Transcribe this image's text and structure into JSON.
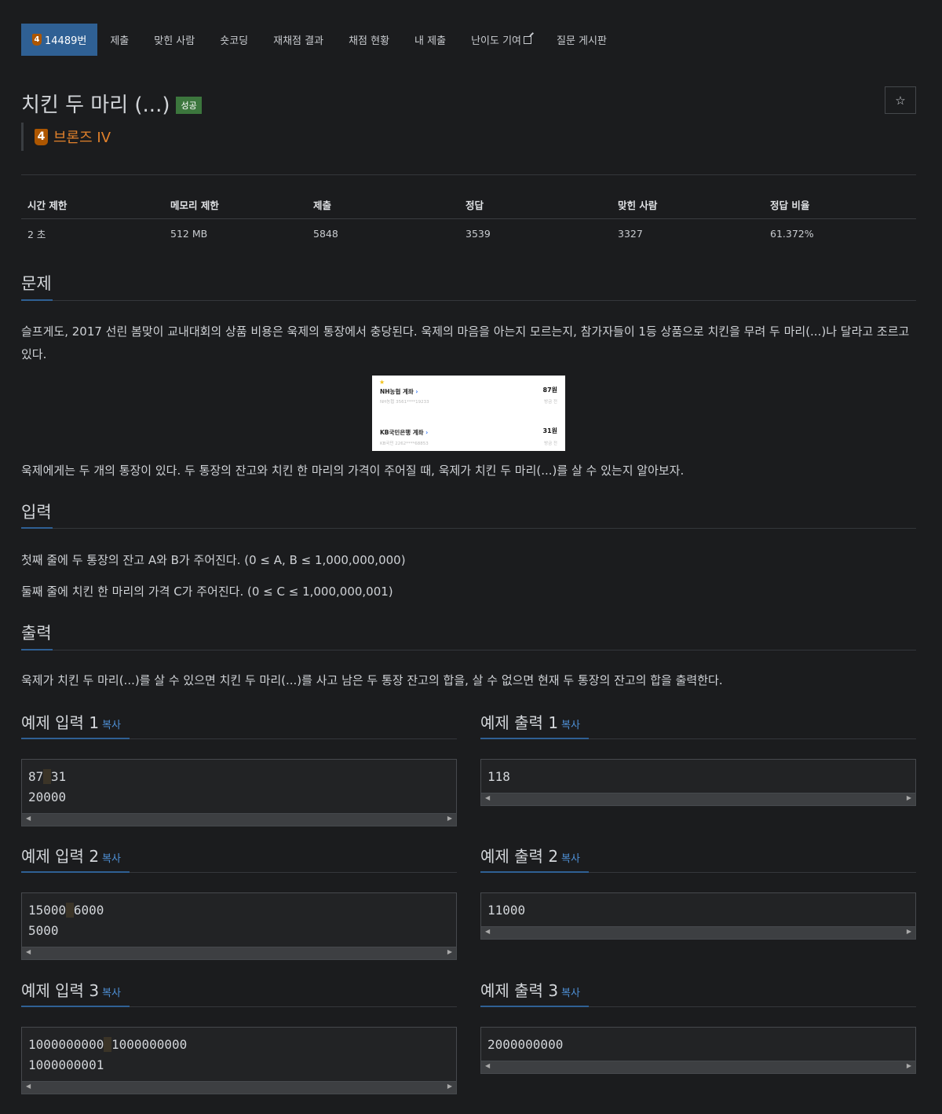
{
  "nav": {
    "problem_tier": "4",
    "problem_id": "14489번",
    "items": [
      "제출",
      "맞힌 사람",
      "숏코딩",
      "재채점 결과",
      "채점 현황",
      "내 제출",
      "난이도 기여",
      "질문 게시판"
    ]
  },
  "header": {
    "title": "치킨 두 마리 (...)",
    "status": "성공",
    "star_icon": "☆",
    "tier_num": "4",
    "tier_label": "브론즈 IV"
  },
  "stats": {
    "headers": [
      "시간 제한",
      "메모리 제한",
      "제출",
      "정답",
      "맞힌 사람",
      "정답 비율"
    ],
    "values": [
      "2 초",
      "512 MB",
      "5848",
      "3539",
      "3327",
      "61.372%"
    ]
  },
  "problem": {
    "title": "문제",
    "para1": "슬프게도, 2017 선린 봄맞이 교내대회의 상품 비용은 욱제의 통장에서 충당된다. 욱제의 마음을 아는지 모르는지, 참가자들이 1등 상품으로 치킨을 무려 두 마리(...)나 달라고 조르고 있다.",
    "para2": "욱제에게는 두 개의 통장이 있다. 두 통장의 잔고와 치킨 한 마리의 가격이 주어질 때, 욱제가 치킨 두 마리(...)를 살 수 있는지 알아보자.",
    "image": {
      "account1_name": "NH농협 계좌",
      "account1_number": "NH농협 3561****19233",
      "account1_amount": "87원",
      "account1_time": "방금 전",
      "account2_name": "KB국민은행 계좌",
      "account2_number": "KB국민 2262****68853",
      "account2_amount": "31원",
      "account2_time": "방금 전"
    }
  },
  "input": {
    "title": "입력",
    "line1": "첫째 줄에 두 통장의 잔고 A와 B가 주어진다. (0 ≤ A, B ≤ 1,000,000,000)",
    "line2": "둘째 줄에 치킨 한 마리의 가격 C가 주어진다. (0 ≤ C ≤ 1,000,000,001)"
  },
  "output": {
    "title": "출력",
    "line1": "욱제가 치킨 두 마리(...)를 살 수 있으면 치킨 두 마리(...)를 사고 남은 두 통장 잔고의 합을, 살 수 없으면 현재 두 통장의 잔고의 합을 출력한다."
  },
  "samples": {
    "copy_label": "복사",
    "in1_title": "예제 입력 1",
    "in1_a": "87",
    "in1_b": "31",
    "in1_c": "20000",
    "out1_title": "예제 출력 1",
    "out1": "118",
    "in2_title": "예제 입력 2",
    "in2_a": "15000",
    "in2_b": "6000",
    "in2_c": "5000",
    "out2_title": "예제 출력 2",
    "out2": "11000",
    "in3_title": "예제 입력 3",
    "in3_a": "1000000000",
    "in3_b": "1000000000",
    "in3_c": "1000000001",
    "out3_title": "예제 출력 3",
    "out3": "2000000000"
  }
}
